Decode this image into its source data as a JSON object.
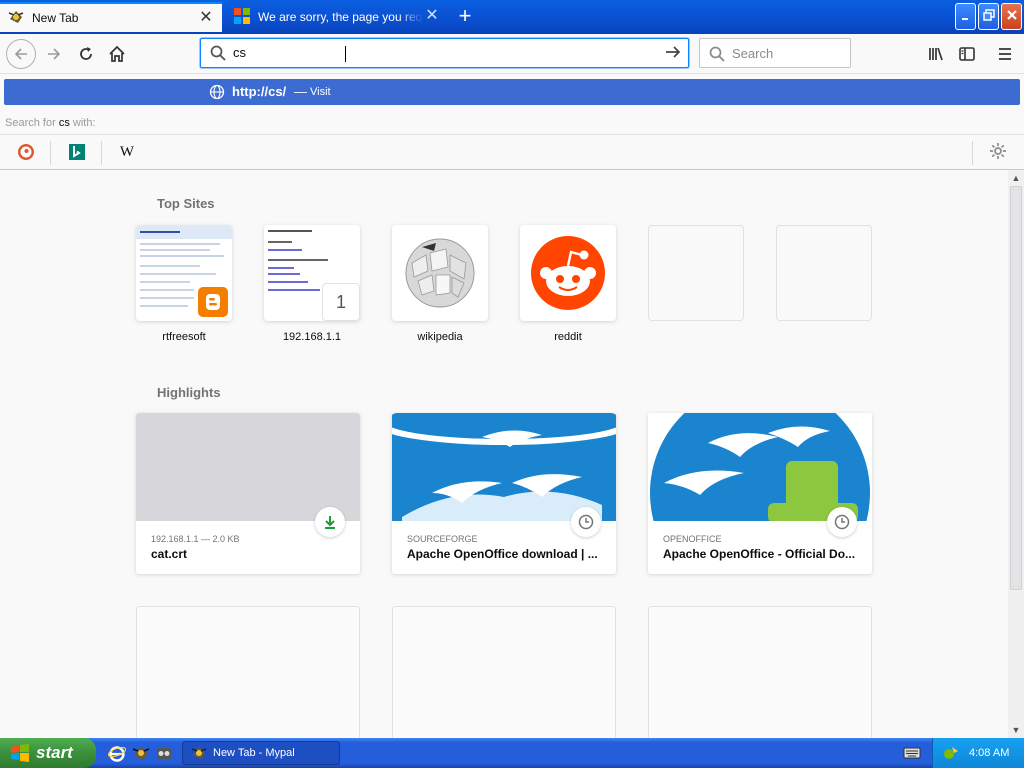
{
  "tabs": [
    {
      "label": "New Tab",
      "close": "✕"
    },
    {
      "label": "We are sorry, the page you requested",
      "close": "✕"
    }
  ],
  "new_tab": "+",
  "urlbar": {
    "value": "cs "
  },
  "searchbar": {
    "placeholder": "Search"
  },
  "suggestion": {
    "url": "http://cs/",
    "dash": "—",
    "action": "Visit"
  },
  "search_for": {
    "prefix": "Search for",
    "term": "cs",
    "suffix": "with:"
  },
  "engines": {
    "wiki": "W"
  },
  "top_sites": {
    "title": "Top Sites",
    "sites": [
      {
        "label": "rtfreesoft"
      },
      {
        "label": "192.168.1.1",
        "badge": "1"
      },
      {
        "label": "wikipedia"
      },
      {
        "label": "reddit"
      },
      {
        "label": ""
      },
      {
        "label": ""
      }
    ]
  },
  "highlights": {
    "title": "Highlights",
    "cards": [
      {
        "context": "192.168.1.1 — 2.0 KB",
        "title": "cat.crt"
      },
      {
        "context": "SOURCEFORGE",
        "title": "Apache OpenOffice download | ..."
      },
      {
        "context": "OPENOFFICE",
        "title": "Apache OpenOffice - Official Do..."
      }
    ]
  },
  "taskbar": {
    "start": "start",
    "task_item": "New Tab - Mypal",
    "clock": "4:08 AM"
  },
  "colors": {
    "accent": "#0a84ff",
    "suggestion_bg": "#3c6cd1",
    "reddit": "#ff4500",
    "blogger": "#f57d00",
    "xp_taskbar": "#245edb",
    "xp_start": "#3c8f3c"
  },
  "icons": [
    "search-icon",
    "globe-icon",
    "reload-icon",
    "home-icon",
    "library-icon",
    "sidebar-icon",
    "menu-icon",
    "settings-icon",
    "download-icon",
    "clock-icon"
  ]
}
